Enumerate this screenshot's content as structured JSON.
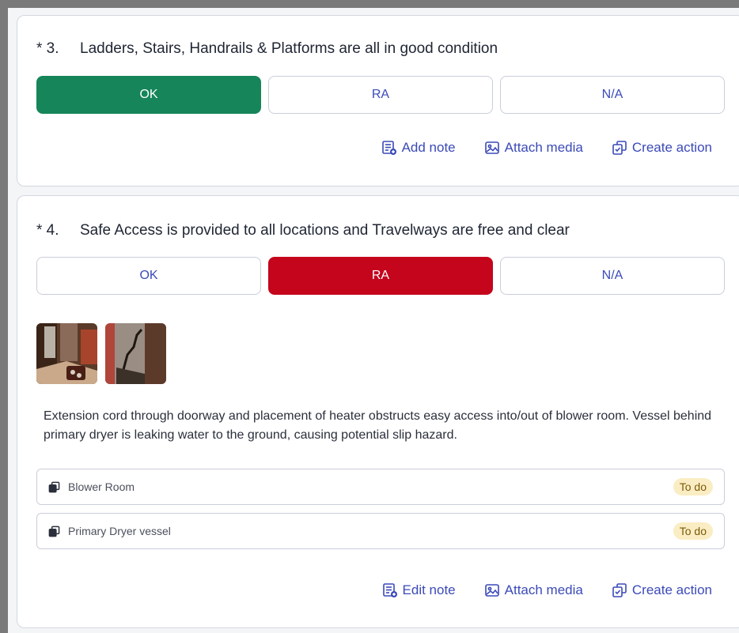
{
  "questions": [
    {
      "number": "* 3.",
      "text": "Ladders, Stairs, Handrails & Platforms are all in good condition",
      "responses": [
        "OK",
        "RA",
        "N/A"
      ],
      "actions": {
        "note": "Add note",
        "media": "Attach media",
        "action": "Create action"
      }
    },
    {
      "number": "* 4.",
      "text": "Safe Access is provided to all locations and Travelways are free and clear",
      "responses": [
        "OK",
        "RA",
        "N/A"
      ],
      "note_text": "Extension cord through doorway and placement of heater obstructs easy access into/out of blower room. Vessel behind primary dryer is leaking water to the ground, causing potential slip hazard.",
      "linked_actions": [
        {
          "label": "Blower Room",
          "status": "To do"
        },
        {
          "label": "Primary Dryer vessel",
          "status": "To do"
        }
      ],
      "actions": {
        "note": "Edit note",
        "media": "Attach media",
        "action": "Create action"
      }
    }
  ],
  "colors": {
    "ok_selected": "#16855a",
    "ra_selected": "#c4051c",
    "link_blue": "#3b4ab8",
    "badge_bg": "#fbedc3"
  },
  "icons": [
    "note-icon",
    "image-icon",
    "create-action-icon",
    "linked-action-icon"
  ]
}
